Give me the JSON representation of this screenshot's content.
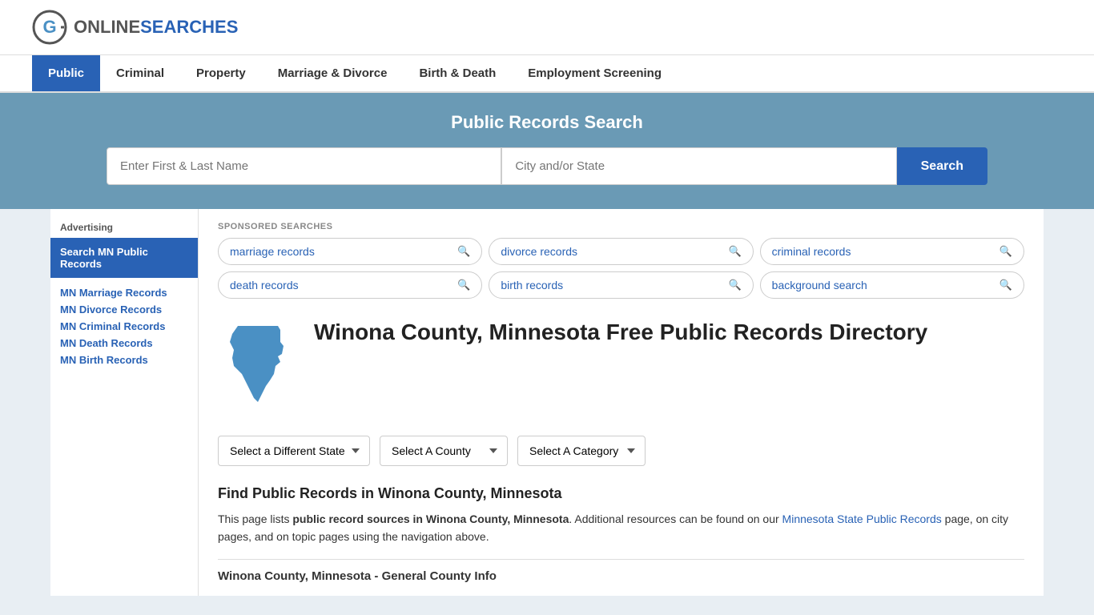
{
  "header": {
    "logo_text_online": "ONLINE",
    "logo_text_searches": "SEARCHES"
  },
  "nav": {
    "items": [
      {
        "label": "Public",
        "active": true
      },
      {
        "label": "Criminal",
        "active": false
      },
      {
        "label": "Property",
        "active": false
      },
      {
        "label": "Marriage & Divorce",
        "active": false
      },
      {
        "label": "Birth & Death",
        "active": false
      },
      {
        "label": "Employment Screening",
        "active": false
      }
    ]
  },
  "search_banner": {
    "title": "Public Records Search",
    "name_placeholder": "Enter First & Last Name",
    "city_placeholder": "City and/or State",
    "button_label": "Search"
  },
  "sponsored": {
    "label": "SPONSORED SEARCHES",
    "pills": [
      {
        "text": "marriage records"
      },
      {
        "text": "divorce records"
      },
      {
        "text": "criminal records"
      },
      {
        "text": "death records"
      },
      {
        "text": "birth records"
      },
      {
        "text": "background search"
      }
    ]
  },
  "page": {
    "title": "Winona County, Minnesota Free Public Records Directory",
    "dropdowns": {
      "state": "Select a Different State",
      "county": "Select A County",
      "category": "Select A Category"
    },
    "find_title": "Find Public Records in Winona County, Minnesota",
    "find_text_1": "This page lists ",
    "find_text_bold": "public record sources in Winona County, Minnesota",
    "find_text_2": ". Additional resources can be found on our ",
    "find_link": "Minnesota State Public Records",
    "find_text_3": " page, on city pages, and on topic pages using the navigation above.",
    "general_info_heading": "Winona County, Minnesota - General County Info"
  },
  "sidebar": {
    "ad_label": "Advertising",
    "ad_box_text": "Search MN Public Records",
    "links": [
      {
        "text": "MN Marriage Records"
      },
      {
        "text": "MN Divorce Records"
      },
      {
        "text": "MN Criminal Records"
      },
      {
        "text": "MN Death Records"
      },
      {
        "text": "MN Birth Records"
      }
    ]
  }
}
